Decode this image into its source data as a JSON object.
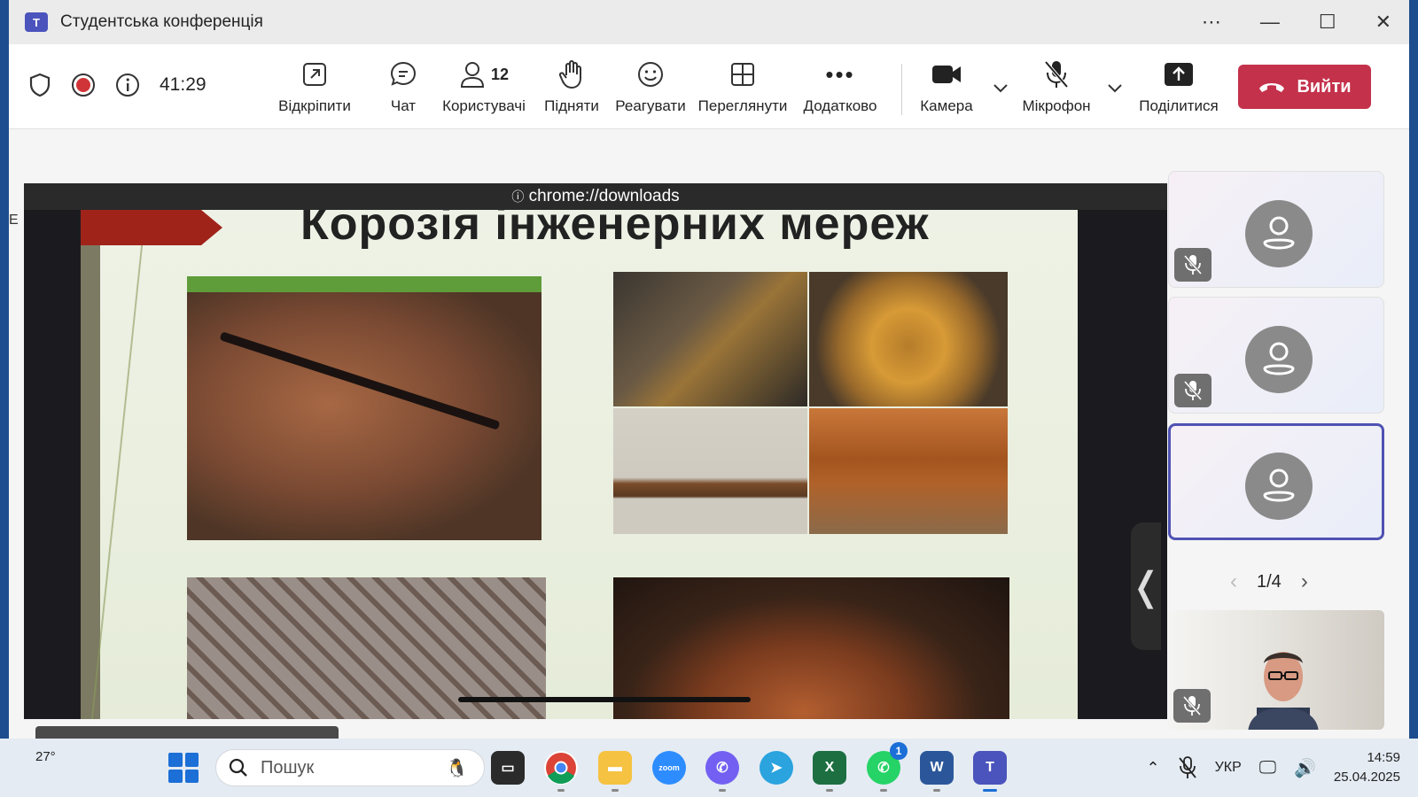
{
  "window": {
    "title": "Студентська конференція",
    "more_icon": "more-horizontal-icon",
    "minimize_icon": "minimize-icon",
    "maximize_icon": "maximize-icon",
    "close_icon": "close-icon"
  },
  "toolbar": {
    "timer": "41:29",
    "items": [
      {
        "label": "Відкріпити",
        "icon": "popout-icon"
      },
      {
        "label": "Чат",
        "icon": "chat-icon"
      },
      {
        "label": "Користувачі",
        "icon": "people-icon",
        "count": "12"
      },
      {
        "label": "Підняти",
        "icon": "raise-hand-icon"
      },
      {
        "label": "Реагувати",
        "icon": "smile-icon"
      },
      {
        "label": "Переглянути",
        "icon": "view-grid-icon"
      },
      {
        "label": "Додатково",
        "icon": "more-icon"
      },
      {
        "label": "Камера",
        "icon": "camera-icon"
      },
      {
        "label": "Мікрофон",
        "icon": "mic-off-icon"
      },
      {
        "label": "Поділитися",
        "icon": "share-icon"
      }
    ],
    "leave_label": "Вийти"
  },
  "stage": {
    "address": "chrome://downloads",
    "slide_title": "Корозія інженерних мереж"
  },
  "participants": {
    "pager": "1/4",
    "tiles": [
      {
        "muted": true,
        "active": false
      },
      {
        "muted": true,
        "active": false
      },
      {
        "muted": true,
        "active": true
      }
    ]
  },
  "taskbar": {
    "weather": "27°",
    "search_placeholder": "Пошук",
    "apps": [
      "file-explorer-app",
      "chrome-app",
      "folder-app",
      "zoom-app",
      "viber-app",
      "telegram-app",
      "excel-app",
      "whatsapp-app",
      "word-app",
      "teams-app"
    ],
    "whatsapp_badge": "1",
    "language": "УКР",
    "time": "14:59",
    "date": "25.04.2025"
  },
  "colors": {
    "accent": "#4f52b2",
    "leave": "#c4314b",
    "record": "#d13438"
  }
}
